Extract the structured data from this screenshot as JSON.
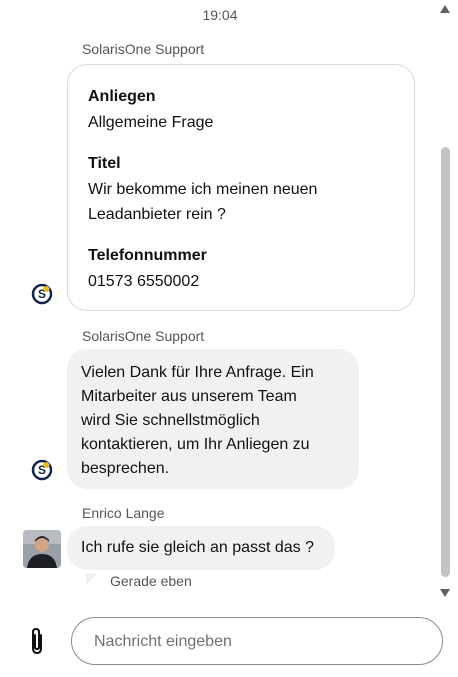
{
  "chat": {
    "timestamp": "19:04",
    "messages": [
      {
        "sender": "SolarisOne Support",
        "card": [
          {
            "label": "Anliegen",
            "lines": [
              "Allgemeine Frage"
            ]
          },
          {
            "label": "Titel",
            "lines": [
              "Wir bekomme ich meinen neuen",
              "Leadanbieter rein ?"
            ]
          },
          {
            "label": "Telefonnummer",
            "lines": [
              "01573 6550002"
            ]
          }
        ]
      },
      {
        "sender": "SolarisOne Support",
        "lines": [
          "Vielen Dank für Ihre Anfrage. Ein",
          "Mitarbeiter aus unserem Team",
          "wird Sie schnellstmöglich",
          "kontaktieren, um Ihr Anliegen zu",
          "besprechen."
        ]
      },
      {
        "sender": "Enrico Lange",
        "text": "Ich rufe sie gleich an passt das ?",
        "status": "Gerade eben"
      }
    ]
  },
  "composer": {
    "placeholder": "Nachricht eingeben",
    "value": ""
  },
  "icons": {
    "attach": "paperclip-icon",
    "bot_avatar": "solarisone-logo",
    "user_avatar": "user-photo"
  },
  "colors": {
    "bubble_bg": "#f0f1f3",
    "card_border": "#d9d9d9",
    "scrollbar": "#c2c2c2",
    "logo_dark": "#12264a",
    "logo_accent": "#f2b51a"
  }
}
